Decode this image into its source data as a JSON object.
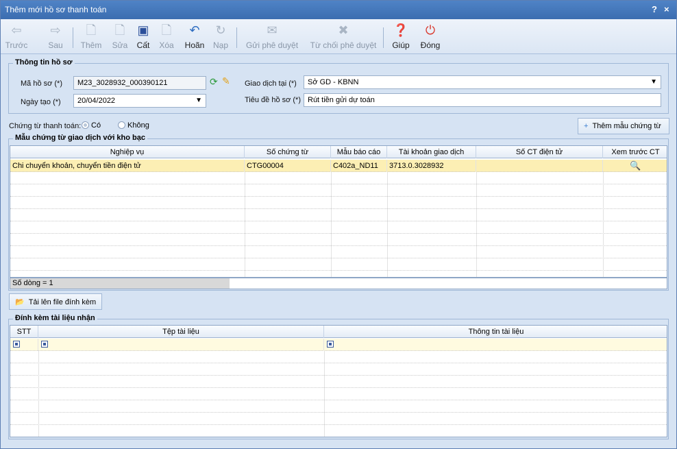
{
  "window": {
    "title": "Thêm mới hồ sơ thanh toán",
    "help": "?",
    "close": "×"
  },
  "toolbar": {
    "back": "Trước",
    "forward": "Sau",
    "add": "Thêm",
    "edit": "Sửa",
    "save": "Cất",
    "delete": "Xóa",
    "undo": "Hoãn",
    "load": "Nạp",
    "send": "Gửi phê duyệt",
    "reject": "Từ chối phê duyệt",
    "help": "Giúp",
    "close": "Đóng"
  },
  "info": {
    "group_title": "Thông tin hồ sơ",
    "code_label": "Mã hồ sơ (*)",
    "code_value": "M23_3028932_000390121",
    "date_label": "Ngày tạo (*)",
    "date_value": "20/04/2022",
    "place_label": "Giao dịch tại (*)",
    "place_value": "Sở GD - KBNN",
    "subject_label": "Tiêu đề hồ sơ (*)",
    "subject_value": "Rút tiền gửi dự toán"
  },
  "payment": {
    "label": "Chứng từ thanh toán:",
    "yes": "Có",
    "no": "Không"
  },
  "add_template_button": "Thêm mẫu chứng từ",
  "templates": {
    "group_title": "Mẫu chứng từ giao dịch với kho bạc",
    "headers": [
      "Nghiệp vụ",
      "Số chứng từ",
      "Mẫu báo cáo",
      "Tài khoản giao dịch",
      "Số CT điện tử",
      "Xem trước CT"
    ],
    "rows": [
      {
        "business": "Chi chuyển khoản, chuyển tiền điện tử",
        "doc_no": "CTG00004",
        "report": "C402a_ND11",
        "account": "3713.0.3028932",
        "e_no": ""
      }
    ],
    "row_count": "Số dòng = 1"
  },
  "upload_button": "Tải lên file đính kèm",
  "attachments": {
    "group_title": "Đính kèm tài liệu nhận",
    "headers": [
      "STT",
      "Tệp tài liệu",
      "Thông tin tài liệu"
    ]
  },
  "colors": {
    "titlebar": "#3b6db0",
    "selected_row": "#fcefb4",
    "panel": "#d6e3f3"
  }
}
